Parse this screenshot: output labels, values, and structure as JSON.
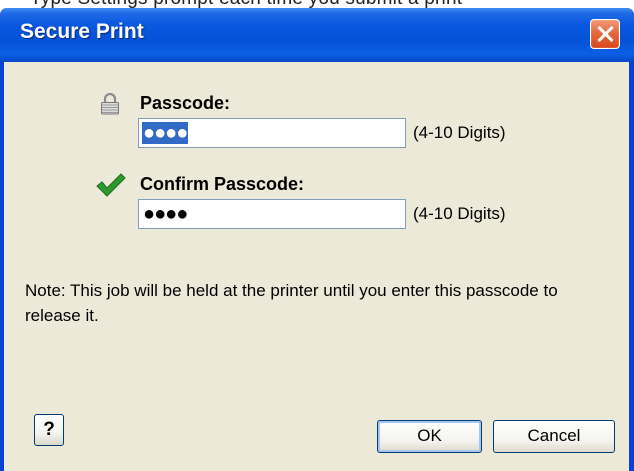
{
  "background_snippet": "Type Settings prompt each time you submit a print",
  "window": {
    "title": "Secure Print"
  },
  "passcode": {
    "label": "Passcode:",
    "value": "●●●●",
    "hint": "(4-10 Digits)"
  },
  "confirm": {
    "label": "Confirm Passcode:",
    "value": "●●●●",
    "hint": "(4-10 Digits)"
  },
  "note": "Note:  This job will be held at the printer until you enter this passcode to release it.",
  "help_label": "?",
  "buttons": {
    "ok": "OK",
    "cancel": "Cancel"
  },
  "icons": {
    "passcode": "lock-icon",
    "confirm": "checkmark-icon",
    "close": "close-icon"
  },
  "colors": {
    "titlebar": "#0a58e0",
    "close_button": "#d8471b",
    "dialog_background": "#ece9d8",
    "selection": "#316ac5",
    "checkmark": "#2e9a2e"
  }
}
